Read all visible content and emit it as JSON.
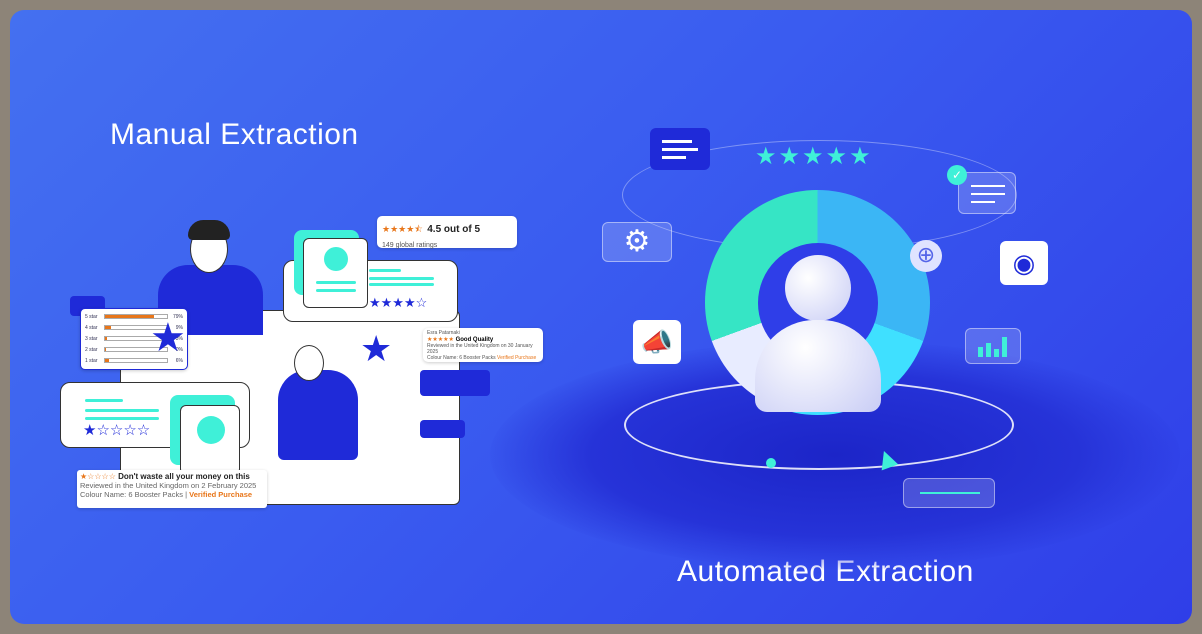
{
  "headings": {
    "left": "Manual Extraction",
    "right": "Automated Extraction"
  },
  "rating_summary": {
    "stars": "★★★★⯪",
    "score": "4.5 out of 5",
    "count": "149 global ratings"
  },
  "histogram": {
    "rows": [
      {
        "label": "5 star",
        "pct": "79%",
        "value": 79
      },
      {
        "label": "4 star",
        "pct": "9%",
        "value": 9
      },
      {
        "label": "3 star",
        "pct": "3%",
        "value": 3
      },
      {
        "label": "2 star",
        "pct": "0%",
        "value": 0
      },
      {
        "label": "1 star",
        "pct": "6%",
        "value": 6
      }
    ]
  },
  "review_good": {
    "author": "Esra Patarnaki",
    "stars": "★★★★★",
    "title": "Good Quality",
    "meta": "Reviewed in the United Kingdom on 30 January 2025",
    "colour": "Colour Name: 6 Booster Packs",
    "verified": "Verified Purchase"
  },
  "review_bad": {
    "stars": "★☆☆☆☆",
    "title": "Don't waste all your money on this",
    "meta": "Reviewed in the United Kingdom on 2 February 2025",
    "colour": "Colour Name: 6 Booster Packs",
    "sep": "|",
    "verified": "Verified Purchase"
  },
  "card_stars": {
    "top": "★★★★☆",
    "bottom": "★☆☆☆☆"
  },
  "hero_stars": "★★★★★",
  "colors": {
    "bg": "#3a5cf0",
    "accent": "#3ff0d8",
    "star_orange": "#e8761a",
    "navy": "#1f2ad8"
  },
  "icons": [
    "chat-icon",
    "gear-icon",
    "megaphone-icon",
    "eye-icon",
    "bar-chart-icon",
    "document-check-icon",
    "zoom-in-icon",
    "cursor-icon",
    "user-icon"
  ]
}
